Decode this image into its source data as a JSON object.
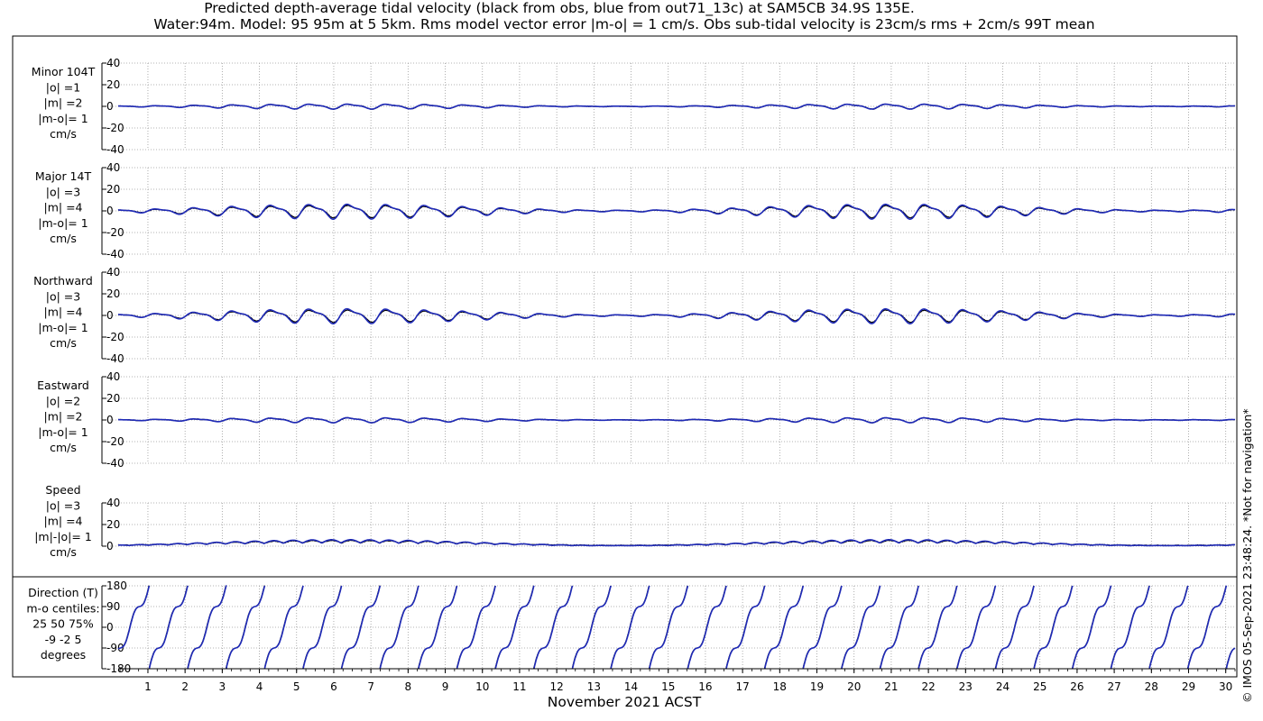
{
  "title_line1": "Predicted depth-average tidal velocity (black from obs, blue from out71_13c) at SAM5CB 34.9S 135E.",
  "title_line2": "Water:94m. Model: 95 95m at 5 5km. Rms model vector error |m-o| = 1 cm/s. Obs sub-tidal velocity is 23cm/s rms + 2cm/s 99T mean",
  "copyright": "© IMOS 05-Sep-2021 23:48:24. *Not for navigation*",
  "colors": {
    "obs": "#000000",
    "model": "#1f2ab8",
    "grid": "#9a9a9a",
    "axis": "#000000"
  },
  "chart_data": {
    "type": "line",
    "xlabel": "November 2021 ACST",
    "x_ticks": [
      "1",
      "2",
      "3",
      "4",
      "5",
      "6",
      "7",
      "8",
      "9",
      "10",
      "11",
      "12",
      "13",
      "14",
      "15",
      "16",
      "17",
      "18",
      "19",
      "20",
      "21",
      "22",
      "23",
      "24",
      "25",
      "26",
      "27",
      "28",
      "29",
      "30"
    ],
    "x_range_days": [
      0.2,
      30.25
    ],
    "series_legend": [
      "black from obs",
      "blue from out71_13c"
    ],
    "panels": [
      {
        "id": "minor",
        "label": [
          "Minor 104T",
          "|o| =1",
          "|m| =2",
          "|m-o|= 1",
          "cm/s"
        ],
        "ylim": [
          -40,
          40
        ],
        "yticks": [
          "40",
          "20",
          "0",
          "-20",
          "-40"
        ],
        "amp_obs": 2,
        "amp_model": 2
      },
      {
        "id": "major",
        "label": [
          "Major 14T",
          "|o| =3",
          "|m| =4",
          "|m-o|= 1",
          "cm/s"
        ],
        "ylim": [
          -40,
          40
        ],
        "yticks": [
          "40",
          "20",
          "0",
          "-20",
          "-40"
        ],
        "amp_obs": 5,
        "amp_model": 6
      },
      {
        "id": "north",
        "label": [
          "Northward",
          "|o| =3",
          "|m| =4",
          "|m-o|= 1",
          "cm/s"
        ],
        "ylim": [
          -40,
          40
        ],
        "yticks": [
          "40",
          "20",
          "0",
          "-20",
          "-40"
        ],
        "amp_obs": 5,
        "amp_model": 6
      },
      {
        "id": "east",
        "label": [
          "Eastward",
          "|o| =2",
          "|m| =2",
          "|m-o|= 1",
          "cm/s"
        ],
        "ylim": [
          -40,
          40
        ],
        "yticks": [
          "40",
          "20",
          "0",
          "-20",
          "-40"
        ],
        "amp_obs": 2,
        "amp_model": 2
      },
      {
        "id": "speed",
        "label": [
          "Speed",
          "|o| =3",
          "|m| =4",
          "|m|-|o|= 1",
          "cm/s"
        ],
        "ylim": [
          0,
          40
        ],
        "yticks": [
          "40",
          "20",
          "0"
        ],
        "amp_obs": 5,
        "amp_model": 6
      },
      {
        "id": "direction",
        "label": [
          "Direction (T)",
          "m-o centiles:",
          "25  50  75%",
          "-9 -2  5",
          "degrees"
        ],
        "ylim": [
          -180,
          180
        ],
        "yticks": [
          "180",
          "90",
          "0",
          "-90",
          "-180"
        ]
      }
    ]
  }
}
